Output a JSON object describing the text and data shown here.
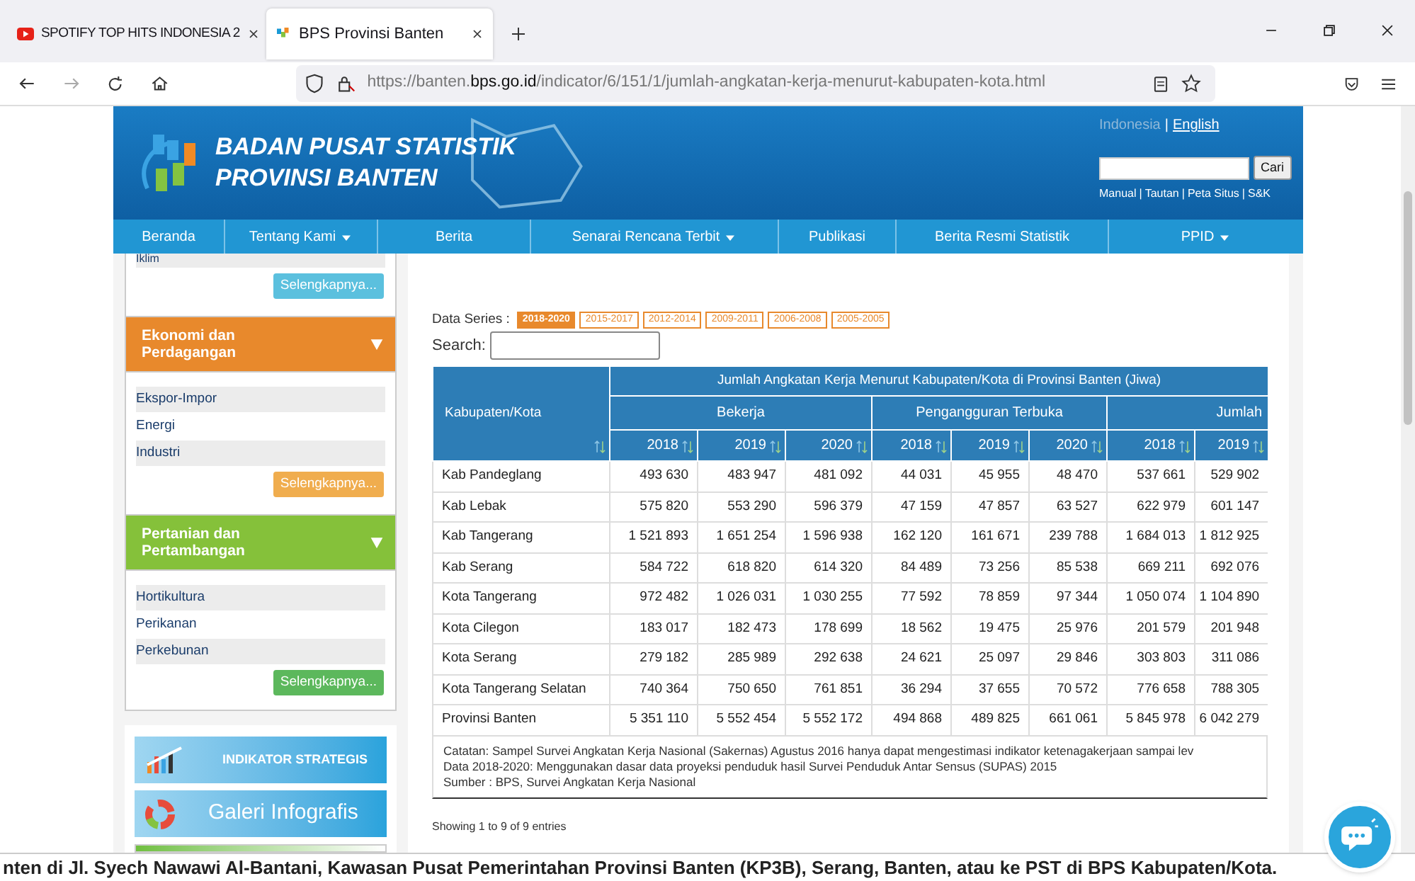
{
  "browser": {
    "tabs": [
      {
        "title": "SPOTIFY TOP HITS INDONESIA 2",
        "kind": "video",
        "selected": false
      },
      {
        "title": "BPS Provinsi Banten",
        "kind": "site",
        "selected": true
      }
    ],
    "url_prefix": "https://banten.",
    "url_domain": "bps.go.id",
    "url_path": "/indicator/6/151/1/jumlah-angkatan-kerja-menurut-kabupaten-kota.html"
  },
  "header": {
    "title_line1": "BADAN PUSAT STATISTIK",
    "title_line2": "PROVINSI BANTEN",
    "languages": [
      {
        "label": "Indonesia",
        "selected": true
      },
      {
        "label": "English",
        "selected": false
      }
    ],
    "separator": "|",
    "search_button": "Cari",
    "links": [
      "Manual",
      "Tautan",
      "Peta Situs",
      "S&K"
    ]
  },
  "nav": [
    {
      "label": "Beranda",
      "has_menu": false
    },
    {
      "label": "Tentang Kami",
      "has_menu": true
    },
    {
      "label": "Berita",
      "has_menu": false
    },
    {
      "label": "Senarai Rencana Terbit",
      "has_menu": true
    },
    {
      "label": "Publikasi",
      "has_menu": false
    },
    {
      "label": "Berita Resmi Statistik",
      "has_menu": false
    },
    {
      "label": "PPID",
      "has_menu": true
    }
  ],
  "sidebar": {
    "top_items": [
      "Iklim"
    ],
    "top_button": "Selengkapnya...",
    "categories": [
      {
        "title": "Ekonomi dan Perdagangan",
        "color": "#e8892c",
        "items": [
          "Ekspor-Impor",
          "Energi",
          "Industri"
        ],
        "button": "Selengkapnya..."
      },
      {
        "title": "Pertanian dan Pertambangan",
        "color": "#85c13a",
        "items": [
          "Hortikultura",
          "Perikanan",
          "Perkebunan"
        ],
        "button": "Selengkapnya..."
      }
    ],
    "banners": [
      {
        "label": "INDIKATOR STRATEGIS",
        "kind": "chart"
      },
      {
        "label": "Galeri Infografis",
        "kind": "donut"
      },
      {
        "kind": "blank"
      }
    ]
  },
  "main": {
    "series_label": "Data Series :",
    "series": [
      {
        "label": "2018-2020",
        "selected": true
      },
      {
        "label": "2015-2017",
        "selected": false
      },
      {
        "label": "2012-2014",
        "selected": false
      },
      {
        "label": "2009-2011",
        "selected": false
      },
      {
        "label": "2006-2008",
        "selected": false
      },
      {
        "label": "2005-2005",
        "selected": false
      }
    ],
    "search_label": "Search:",
    "table": {
      "region_header": "Kabupaten/Kota",
      "title": "Jumlah Angkatan Kerja Menurut Kabupaten/Kota di Provinsi Banten (Jiwa)",
      "groups": [
        {
          "label": "Bekerja",
          "years": [
            "2018",
            "2019",
            "2020"
          ]
        },
        {
          "label": "Pengangguran Terbuka",
          "years": [
            "2018",
            "2019",
            "2020"
          ]
        },
        {
          "label": "Jumlah",
          "years": [
            "2018",
            "2019"
          ]
        }
      ],
      "rows": [
        [
          "Kab Pandeglang",
          "493 630",
          "483 947",
          "481 092",
          "44 031",
          "45 955",
          "48 470",
          "537 661",
          "529 902"
        ],
        [
          "Kab Lebak",
          "575 820",
          "553 290",
          "596 379",
          "47 159",
          "47 857",
          "63 527",
          "622 979",
          "601 147"
        ],
        [
          "Kab Tangerang",
          "1 521 893",
          "1 651 254",
          "1 596 938",
          "162 120",
          "161 671",
          "239 788",
          "1 684 013",
          "1 812 925"
        ],
        [
          "Kab Serang",
          "584 722",
          "618 820",
          "614 320",
          "84 489",
          "73 256",
          "85 538",
          "669 211",
          "692 076"
        ],
        [
          "Kota Tangerang",
          "972 482",
          "1 026 031",
          "1 030 255",
          "77 592",
          "78 859",
          "97 344",
          "1 050 074",
          "1 104 890"
        ],
        [
          "Kota Cilegon",
          "183 017",
          "182 473",
          "178 699",
          "18 562",
          "19 475",
          "25 976",
          "201 579",
          "201 948"
        ],
        [
          "Kota Serang",
          "279 182",
          "285 989",
          "292 638",
          "24 621",
          "25 097",
          "29 846",
          "303 803",
          "311 086"
        ],
        [
          "Kota Tangerang Selatan",
          "740 364",
          "750 650",
          "761 851",
          "36 294",
          "37 655",
          "70 572",
          "776 658",
          "788 305"
        ],
        [
          "Provinsi Banten",
          "5 351 110",
          "5 552 454",
          "5 552 172",
          "494 868",
          "489 825",
          "661 061",
          "5 845 978",
          "6 042 279"
        ]
      ]
    },
    "notes": [
      "Catatan: Sampel Survei Angkatan Kerja Nasional (Sakernas) Agustus 2016 hanya dapat mengestimasi indikator ketenagakerjaan sampai lev",
      "Data 2018-2020: Menggunakan dasar data proyeksi penduduk hasil Survei Penduduk Antar Sensus (SUPAS) 2015",
      "Sumber : BPS, Survei Angkatan Kerja Nasional"
    ],
    "entries": "Showing 1 to 9 of 9 entries"
  },
  "marquee": "nten di Jl. Syech Nawawi Al-Bantani, Kawasan Pusat Pemerintahan Provinsi Banten (KP3B), Serang, Banten, atau ke PST di BPS Kabupaten/Kota."
}
